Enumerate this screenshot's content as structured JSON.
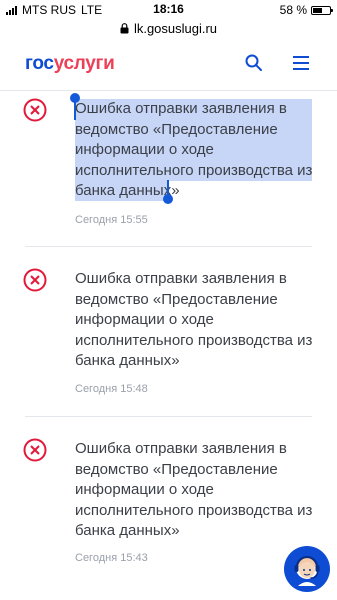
{
  "status_bar": {
    "carrier": "MTS RUS",
    "network": "LTE",
    "time": "18:16",
    "battery": "58 %",
    "battery_level": 0.58
  },
  "browser": {
    "url": "lk.gosuslugi.ru"
  },
  "header": {
    "logo_part1": "гос",
    "logo_part2": "услуги"
  },
  "notifications": [
    {
      "text": "Ошибка отправки заявления в ведомство «Предоставление информации о ходе исполнительного производства из банка данных»",
      "time": "Сегодня 15:55"
    },
    {
      "text": "Ошибка отправки заявления в ведомство «Предоставление информации о ходе исполнительного производства из банка данных»",
      "time": "Сегодня 15:48"
    },
    {
      "text": "Ошибка отправки заявления в ведомство «Предоставление информации о ходе исполнительного производства из банка данных»",
      "time": "Сегодня 15:43"
    }
  ],
  "colors": {
    "brand_blue": "#0d4cd3",
    "brand_red": "#ee3f58",
    "error_red": "#e3193b",
    "selection": "#c7d6f7"
  },
  "icons": {
    "error": "x-circle-icon",
    "search": "search-icon",
    "menu": "hamburger-menu-icon",
    "support": "support-operator-icon"
  }
}
